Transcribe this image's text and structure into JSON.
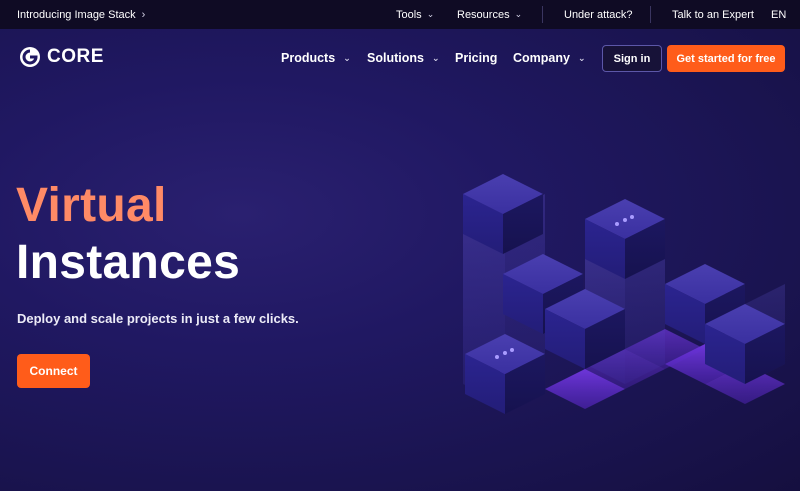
{
  "topbar": {
    "announcement": "Introducing Image Stack",
    "tools": "Tools",
    "resources": "Resources",
    "under_attack": "Under attack?",
    "talk_expert": "Talk to an Expert",
    "language": "EN"
  },
  "nav": {
    "logo_text": "CORE",
    "products": "Products",
    "solutions": "Solutions",
    "pricing": "Pricing",
    "company": "Company",
    "sign_in": "Sign in",
    "get_started": "Get started for free"
  },
  "hero": {
    "title_line1": "Virtual",
    "title_line2": "Instances",
    "subtitle": "Deploy and scale projects in just a few clicks.",
    "cta": "Connect"
  },
  "colors": {
    "accent": "#ff5c1a",
    "title_highlight": "#ff8a66",
    "background": "#1d1649",
    "topbar": "#0f0b24"
  },
  "icons": {
    "logo": "core-logo-icon",
    "chevron_down": "chevron-down-icon",
    "chevron_right": "chevron-right-icon",
    "illustration": "isometric-cubes-illustration"
  }
}
